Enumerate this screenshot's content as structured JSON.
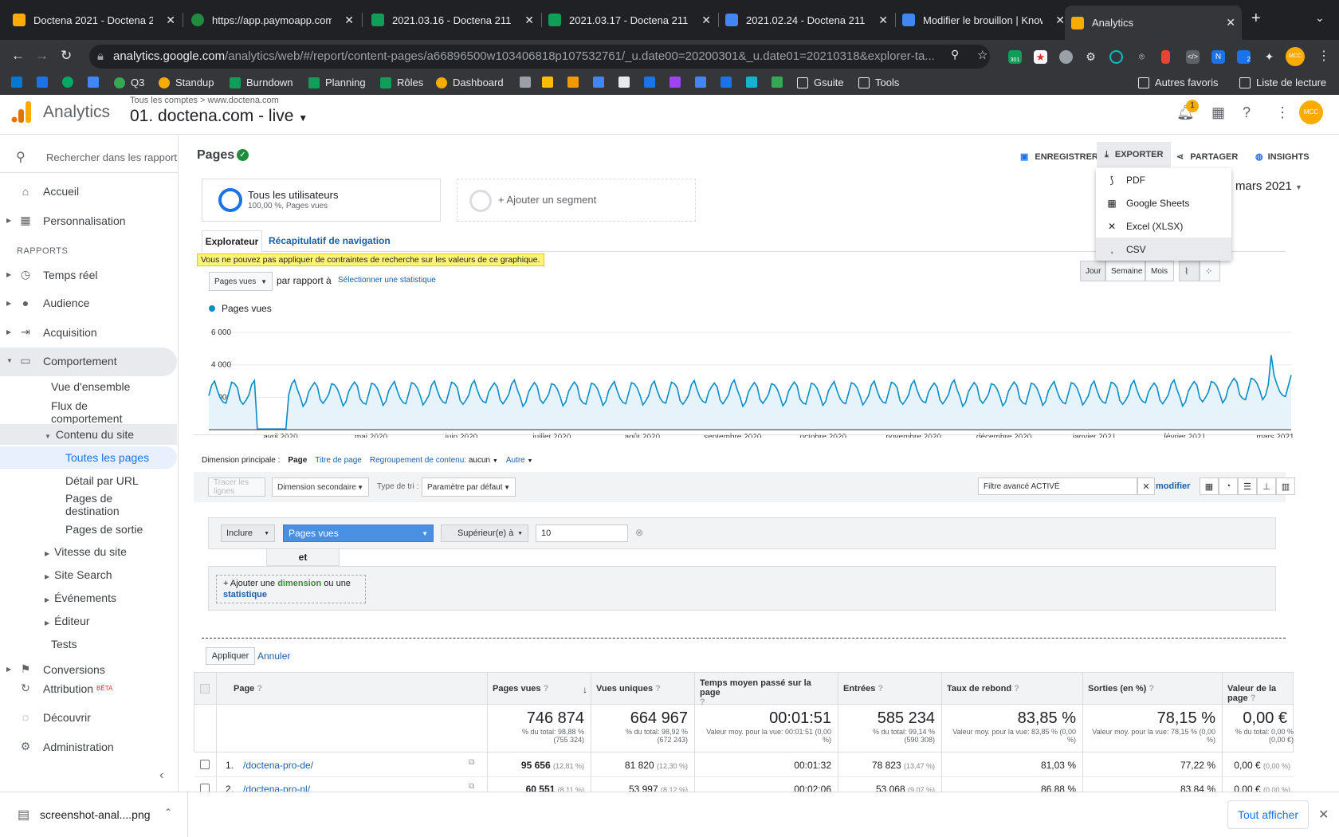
{
  "browser": {
    "tabs": [
      {
        "title": "Doctena 2021 - Doctena 20",
        "color": "#f9ab00"
      },
      {
        "title": "https://app.paymoapp.com/",
        "color": "#1e8e3e"
      },
      {
        "title": "2021.03.16 - Doctena 2112",
        "color": "#0f9d58"
      },
      {
        "title": "2021.03.17 - Doctena 2112",
        "color": "#0f9d58"
      },
      {
        "title": "2021.02.24 - Doctena 2112",
        "color": "#4285f4"
      },
      {
        "title": "Modifier le brouillon | Know",
        "color": "#4285f4"
      },
      {
        "title": "Analytics",
        "color": "#f9ab00"
      }
    ],
    "url_domain": "analytics.google.com",
    "url_path": "/analytics/web/#/report/content-pages/a66896500w103406818p107532761/_u.date00=20200301&_u.date01=20210318&explorer-ta...",
    "ext_badges": {
      "badge_301": "301",
      "badge_2": "2",
      "avatar": "MCC"
    },
    "bookmarks": [
      {
        "label": "Q3",
        "color": "#34a853"
      },
      {
        "label": "Standup",
        "color": "#f9ab00"
      },
      {
        "label": "Burndown",
        "color": "#0f9d58"
      },
      {
        "label": "Planning",
        "color": "#0f9d58"
      },
      {
        "label": "Rôles",
        "color": "#0f9d58"
      },
      {
        "label": "Dashboard",
        "color": "#f9ab00"
      },
      {
        "label": "Gsuite",
        "color": "#9aa0a6"
      },
      {
        "label": "Tools",
        "color": "#9aa0a6"
      }
    ],
    "bookmarks_right": [
      "Autres favoris",
      "Liste de lecture"
    ]
  },
  "header": {
    "app_name": "Analytics",
    "account_path": "Tous les comptes  >  www.doctena.com",
    "property": "01. doctena.com - live",
    "notif_count": "1",
    "avatar": "MCC"
  },
  "sidebar": {
    "search_placeholder": "Rechercher dans les rapport",
    "home": "Accueil",
    "custom": "Personnalisation",
    "section_reports": "RAPPORTS",
    "realtime": "Temps réel",
    "audience": "Audience",
    "acquisition": "Acquisition",
    "behavior": "Comportement",
    "overview": "Vue d'ensemble",
    "flow": "Flux de comportement",
    "site_content": "Contenu du site",
    "all_pages": "Toutes les pages",
    "drilldown": "Détail par URL",
    "landing": "Pages de destination",
    "exit": "Pages de sortie",
    "speed": "Vitesse du site",
    "site_search": "Site Search",
    "events": "Événements",
    "publisher": "Éditeur",
    "tests": "Tests",
    "conversions": "Conversions",
    "attribution": "Attribution",
    "beta": "BÊTA",
    "discover": "Découvrir",
    "admin": "Administration"
  },
  "report": {
    "title": "Pages",
    "save": "ENREGISTRER",
    "export": "EXPORTER",
    "share": "PARTAGER",
    "insights": "INSIGHTS",
    "export_menu": [
      "PDF",
      "Google Sheets",
      "Excel (XLSX)",
      "CSV"
    ],
    "date_tail": "mars 2021",
    "segment_name": "Tous les utilisateurs",
    "segment_sub": "100,00 %, Pages vues",
    "add_segment": "+ Ajouter un segment",
    "tab_explorer": "Explorateur",
    "tab_nav": "Récapitulatif de navigation",
    "warning": "Vous ne pouvez pas appliquer de contraintes de recherche sur les valeurs de ce graphique.",
    "metric_select": "Pages vues",
    "versus": "par rapport à",
    "select_stat": "Sélectionner une statistique",
    "period_day": "Jour",
    "period_week": "Semaine",
    "period_month": "Mois",
    "legend": "Pages vues",
    "primary_dim_label": "Dimension principale :",
    "dim_page": "Page",
    "dim_title": "Titre de page",
    "dim_group": "Regroupement de contenu:",
    "dim_group_val": "aucun",
    "dim_other": "Autre",
    "plot_rows": "Tracer les lignes",
    "secondary_dim": "Dimension secondaire",
    "sort_type_label": "Type de tri :",
    "sort_default": "Paramètre par défaut",
    "advanced_filter": "Filtre avancé ACTIVÉ",
    "modify": "modifier",
    "filter_include": "Inclure",
    "filter_metric": "Pages vues",
    "filter_op": "Supérieur(e) à",
    "filter_value": "10",
    "and": "et",
    "add_dim_prefix": "+ Ajouter une",
    "add_dim_mid": "dimension",
    "add_dim_or": "ou une",
    "add_dim_stat": "statistique",
    "apply": "Appliquer",
    "cancel": "Annuler"
  },
  "chart_data": {
    "type": "line",
    "series": [
      {
        "name": "Pages vues"
      }
    ],
    "ylim": [
      0,
      6000
    ],
    "yticks": [
      "6 000",
      "4 000",
      "2 000"
    ],
    "xticks": [
      "avril 2020",
      "mai 2020",
      "juin 2020",
      "juillet 2020",
      "août 2020",
      "septembre 2020",
      "octobre 2020",
      "novembre 2020",
      "décembre 2020",
      "janvier 2021",
      "février 2021",
      "mars 2021"
    ],
    "weekly_pattern_min": 1500,
    "weekly_pattern_max": 3000,
    "gap_start": "avril 2020",
    "peak_value": 4600
  },
  "table": {
    "headers": [
      "Page",
      "Pages vues",
      "Vues uniques",
      "Temps moyen passé sur la page",
      "Entrées",
      "Taux de rebond",
      "Sorties (en %)",
      "Valeur de la page"
    ],
    "totals": [
      {
        "value": "746 874",
        "sub": "% du total: 98,88 % (755 324)"
      },
      {
        "value": "664 967",
        "sub": "% du total: 98,92 % (672 243)"
      },
      {
        "value": "00:01:51",
        "sub": "Valeur moy. pour la vue: 00:01:51 (0,00 %)"
      },
      {
        "value": "585 234",
        "sub": "% du total: 99,14 % (590 308)"
      },
      {
        "value": "83,85 %",
        "sub": "Valeur moy. pour la vue: 83,85 % (0,00 %)"
      },
      {
        "value": "78,15 %",
        "sub": "Valeur moy. pour la vue: 78,15 % (0,00 %)"
      },
      {
        "value": "0,00 €",
        "sub": "% du total: 0,00 % (0,00 €)"
      }
    ],
    "rows": [
      {
        "idx": "1.",
        "page": "/doctena-pro-de/",
        "pv": "95 656",
        "pv_pct": "(12,81 %)",
        "uv": "81 820",
        "uv_pct": "(12,30 %)",
        "time": "00:01:32",
        "ent": "78 823",
        "ent_pct": "(13,47 %)",
        "bounce": "81,03 %",
        "exit": "77,22 %",
        "val": "0,00 €",
        "val_pct": "(0,00 %)"
      },
      {
        "idx": "2.",
        "page": "/doctena-pro-nl/",
        "pv": "60 551",
        "pv_pct": "(8,11 %)",
        "uv": "53 997",
        "uv_pct": "(8,12 %)",
        "time": "00:02:06",
        "ent": "53 068",
        "ent_pct": "(9,07 %)",
        "bounce": "86,88 %",
        "exit": "83,84 %",
        "val": "0,00 €",
        "val_pct": "(0,00 %)"
      }
    ]
  },
  "downloads": {
    "file": "screenshot-anal....png",
    "show_all": "Tout afficher"
  }
}
